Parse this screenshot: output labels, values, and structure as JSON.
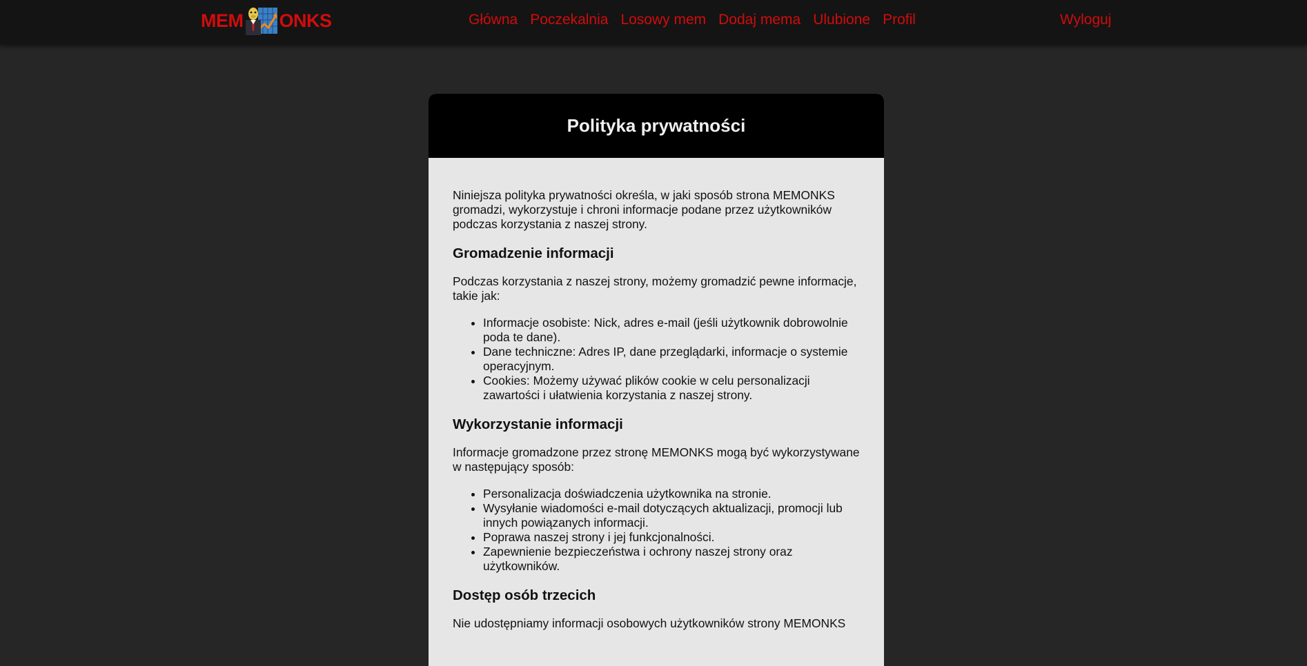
{
  "header": {
    "logo_left": "MEM",
    "logo_right": "ONKS",
    "nav": [
      "Główna",
      "Poczekalnia",
      "Losowy mem",
      "Dodaj mema",
      "Ulubione",
      "Profil"
    ],
    "logout": "Wyloguj"
  },
  "colors": {
    "accent": "#d10c0c",
    "page_bg": "#262626",
    "topbar_bg": "#141414",
    "card_bg": "#e6e6e6",
    "card_header_bg": "#000000"
  },
  "policy": {
    "title": "Polityka prywatności",
    "intro": "Niniejsza polityka prywatności określa, w jaki sposób strona MEMONKS gromadzi, wykorzystuje i chroni informacje podane przez użytkowników podczas korzystania z naszej strony.",
    "sections": [
      {
        "heading": "Gromadzenie informacji",
        "text": "Podczas korzystania z naszej strony, możemy gromadzić pewne informacje, takie jak:",
        "items": [
          "Informacje osobiste: Nick, adres e-mail (jeśli użytkownik dobrowolnie poda te dane).",
          "Dane techniczne: Adres IP, dane przeglądarki, informacje o systemie operacyjnym.",
          "Cookies: Możemy używać plików cookie w celu personalizacji zawartości i ułatwienia korzystania z naszej strony."
        ]
      },
      {
        "heading": "Wykorzystanie informacji",
        "text": "Informacje gromadzone przez stronę MEMONKS mogą być wykorzystywane w następujący sposób:",
        "items": [
          "Personalizacja doświadczenia użytkownika na stronie.",
          "Wysyłanie wiadomości e-mail dotyczących aktualizacji, promocji lub innych powiązanych informacji.",
          "Poprawa naszej strony i jej funkcjonalności.",
          "Zapewnienie bezpieczeństwa i ochrony naszej strony oraz użytkowników."
        ]
      },
      {
        "heading": "Dostęp osób trzecich",
        "text": "Nie udostępniamy informacji osobowych użytkowników strony MEMONKS"
      }
    ]
  }
}
